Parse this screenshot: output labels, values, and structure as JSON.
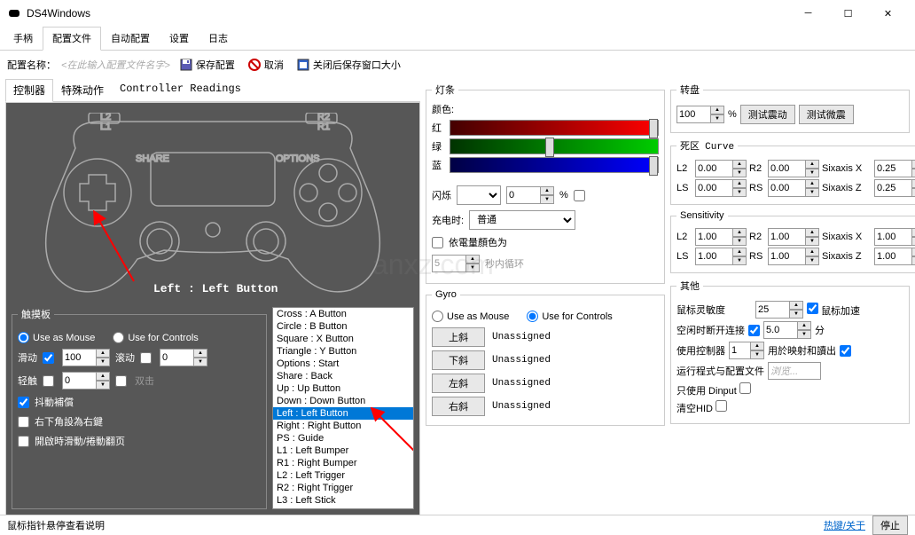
{
  "window": {
    "title": "DS4Windows"
  },
  "maintabs": [
    "手柄",
    "配置文件",
    "自动配置",
    "设置",
    "日志"
  ],
  "active_maintab": 1,
  "toolbar": {
    "config_name_label": "配置名称：",
    "config_name_placeholder": "<在此输入配置文件名字>",
    "save": "保存配置",
    "cancel": "取消",
    "keep_size": "关闭后保存窗口大小"
  },
  "subtabs": [
    "控制器",
    "特殊动作",
    "Controller Readings"
  ],
  "active_subtab": 0,
  "controller_label": "Left : Left Button",
  "touchpad": {
    "legend": "触摸板",
    "use_as_mouse": "Use as Mouse",
    "use_for_controls": "Use for Controls",
    "selected": "mouse",
    "slide_label": "滑动",
    "slide_checked": true,
    "slide_value": "100",
    "scroll_label": "滚动",
    "scroll_checked": false,
    "scroll_value": "0",
    "tap_label": "轻触",
    "tap_checked": false,
    "tap_value": "0",
    "doubletap_label": "双击",
    "doubletap_checked": false,
    "jitter_label": "抖動補償",
    "jitter_checked": true,
    "lowerright_label": "右下角設為右鍵",
    "lowerright_checked": false,
    "startup_label": "開啟時滑動/捲動翻页",
    "startup_checked": false
  },
  "mappings": [
    "Cross : A Button",
    "Circle : B Button",
    "Square : X Button",
    "Triangle : Y Button",
    "Options : Start",
    "Share : Back",
    "Up : Up Button",
    "Down : Down Button",
    "Left : Left Button",
    "Right : Right Button",
    "PS : Guide",
    "L1 : Left Bumper",
    "R1 : Right Bumper",
    "L2 : Left Trigger",
    "R2 : Right Trigger",
    "L3 : Left Stick"
  ],
  "selected_mapping": 8,
  "lightbar": {
    "legend": "灯条",
    "color_label": "颜色:",
    "red_label": "红",
    "green_label": "绿",
    "blue_label": "蓝",
    "flash_label": "闪烁",
    "flash_value": "0",
    "charging_label": "充电时:",
    "charging_option": "普通",
    "battery_label": "依電量顏色为",
    "battery_checked": false,
    "pulse_label": "秒内循环",
    "pulse_value": "5"
  },
  "gyro": {
    "legend": "Gyro",
    "use_as_mouse": "Use as Mouse",
    "use_for_controls": "Use for Controls",
    "selected": "controls",
    "tilt_up": "上斜",
    "tilt_down": "下斜",
    "tilt_left": "左斜",
    "tilt_right": "右斜",
    "unassigned": "Unassigned"
  },
  "rumble": {
    "legend": "转盘",
    "value": "100",
    "test_heavy": "测试震动",
    "test_light": "测试微震"
  },
  "deadzone": {
    "legend": "死区",
    "curve": "Curve",
    "l2": "L2",
    "l2_val": "0.00",
    "r2": "R2",
    "r2_val": "0.00",
    "sixx": "Sixaxis X",
    "sixx_val": "0.25",
    "ls": "LS",
    "ls_val": "0.00",
    "rs": "RS",
    "rs_val": "0.00",
    "sixz": "Sixaxis Z",
    "sixz_val": "0.25"
  },
  "sensitivity": {
    "legend": "Sensitivity",
    "l2": "L2",
    "l2_val": "1.00",
    "r2": "R2",
    "r2_val": "1.00",
    "sixx": "Sixaxis X",
    "sixx_val": "1.00",
    "ls": "LS",
    "ls_val": "1.00",
    "rs": "RS",
    "rs_val": "1.00",
    "sixz": "Sixaxis Z",
    "sixz_val": "1.00"
  },
  "other": {
    "legend": "其他",
    "mouse_sens_label": "鼠标灵敏度",
    "mouse_sens_value": "25",
    "mouse_accel_label": "鼠标加速",
    "mouse_accel_checked": true,
    "idle_label": "空闲时断开连接",
    "idle_checked": true,
    "idle_value": "5.0",
    "idle_unit": "分",
    "use_controller_label": "使用控制器",
    "use_controller_value": "1",
    "use_controller_rest": "用於映射和讀出",
    "use_controller_checked": true,
    "launch_label": "运行程式与配置文件",
    "launch_placeholder": "浏览...",
    "dinput_label": "只使用 Dinput",
    "dinput_checked": false,
    "flush_hid_label": "清空HID",
    "flush_hid_checked": false
  },
  "status": {
    "hint": "鼠标指针悬停查看说明",
    "hotkeys": "热键/关于",
    "stop": "停止"
  }
}
